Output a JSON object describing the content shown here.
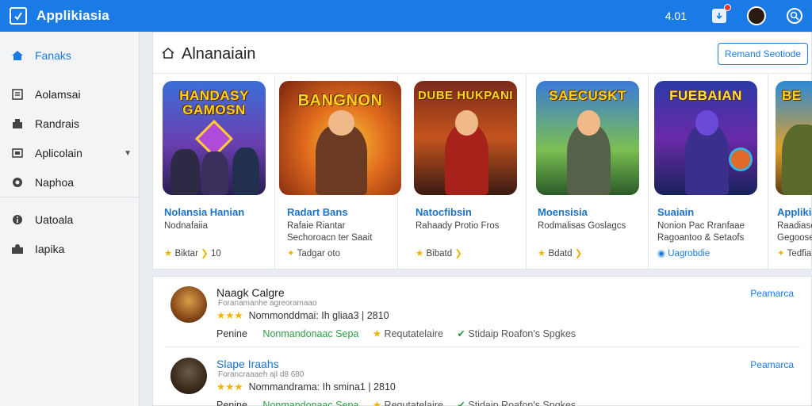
{
  "app": {
    "name": "Applikiasia",
    "count": "4.01",
    "colors": {
      "accent": "#1a7be6"
    }
  },
  "sidebar": {
    "items": [
      {
        "label": "Fanaks",
        "icon": "home-icon"
      },
      {
        "label": "Aolamsai",
        "icon": "grid-icon"
      },
      {
        "label": "Randrais",
        "icon": "box-icon"
      },
      {
        "label": "Aplicolain",
        "icon": "app-icon"
      },
      {
        "label": "Naphoa",
        "icon": "shield-icon"
      },
      {
        "label": "Uatoala",
        "icon": "info-icon"
      },
      {
        "label": "Iapika",
        "icon": "puzzle-icon"
      }
    ]
  },
  "header": {
    "title": "Alnanaiain",
    "button_label": "Remand Seotiode"
  },
  "cards": [
    {
      "art_title": "HANDASY GAMOSN",
      "name": "Nolansia Hanian",
      "sub1": "Nodnafaiia",
      "sub2": "",
      "meta": "Biktar",
      "meta_num": "10"
    },
    {
      "art_title": "BANGNON",
      "name": "Radart Bans",
      "sub1": "Rafaie Riantar",
      "sub2": "Sechoroacn ter Saait",
      "meta": "Tadgar oto",
      "meta_num": ""
    },
    {
      "art_title": "DUBE HUKPANI",
      "name": "Natocfibsin",
      "sub1": "Rahaady Protio Fros",
      "sub2": "",
      "meta": "Bibatd",
      "meta_num": ""
    },
    {
      "art_title": "SAECUSKT",
      "name": "Moensisia",
      "sub1": "Rodmalisas Goslagcs",
      "sub2": "",
      "meta": "Bdatd",
      "meta_num": ""
    },
    {
      "art_title": "FUEBAIAN",
      "name": "Suaiain",
      "sub1": "Nonion Pac Rranfaae",
      "sub2": "Ragoantoo & Setaofs",
      "meta": "Uagrobdie",
      "meta_num": ""
    },
    {
      "art_title": "BE",
      "name": "Applikia",
      "sub1": "Raadiase",
      "sub2": "Gegoose",
      "meta": "Tedfiar",
      "meta_num": ""
    }
  ],
  "reviews": [
    {
      "name": "Naagk Calgre",
      "rating_text": "Nommonddmai: Ih gliaa3 | 2810",
      "small": "Foranamanhe agreoramaao",
      "tag1": "Penine",
      "tag2": "Nonmandonaac Sepa",
      "tag3": "Requtatelaire",
      "tag4": "Stidaip Roafon's Spgkes",
      "link": "Peamarca"
    },
    {
      "name": "Slape Iraahs",
      "rating_text": "Nommandrama: Ih smina1 | 2810",
      "small": "Forancraaaeh ajl d8 680",
      "tag1": "Penine",
      "tag2": "Nonmandonaac Sepa",
      "tag3": "Requtatelaire",
      "tag4": "Stidaip Roafon's Spgkes",
      "link": "Peamarca"
    }
  ]
}
